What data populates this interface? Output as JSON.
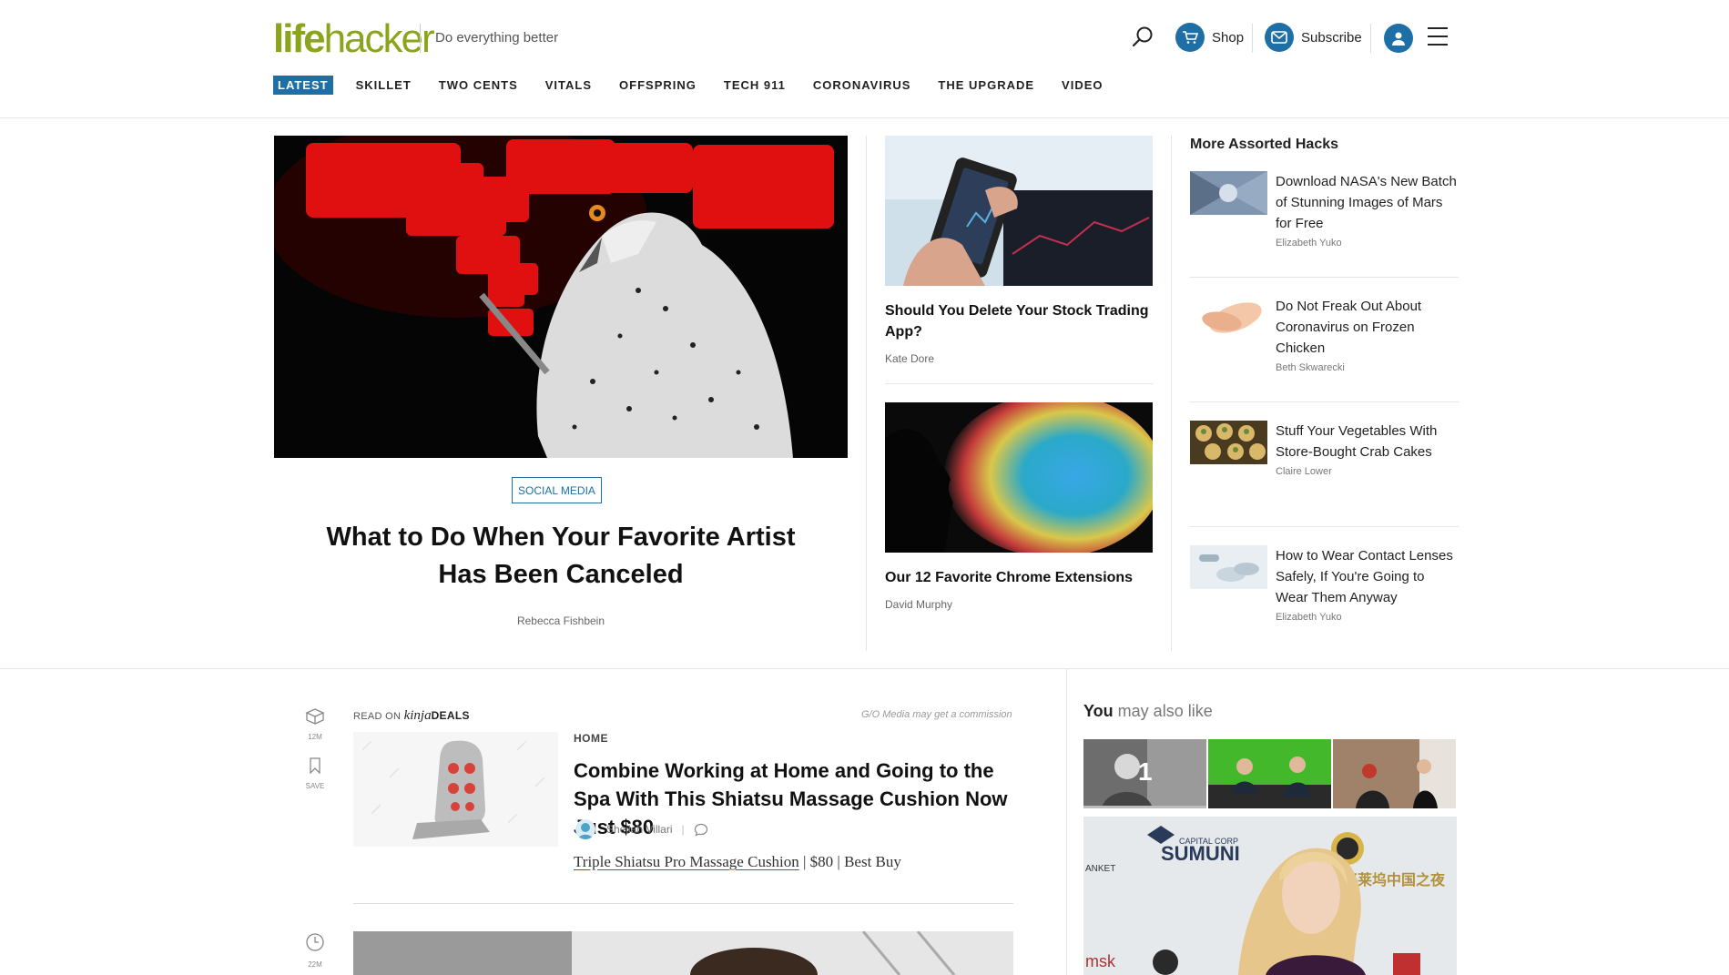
{
  "site": {
    "logo_part1": "life",
    "logo_part2": "hacker",
    "tagline": "Do everything better"
  },
  "header": {
    "shop_label": "Shop",
    "subscribe_label": "Subscribe"
  },
  "nav": [
    "LATEST",
    "SKILLET",
    "TWO CENTS",
    "VITALS",
    "OFFSPRING",
    "TECH 911",
    "CORONAVIRUS",
    "THE UPGRADE",
    "VIDEO"
  ],
  "hero": {
    "tag": "SOCIAL MEDIA",
    "title": "What to Do When Your Favorite Artist Has Been Canceled",
    "author": "Rebecca Fishbein"
  },
  "middle": [
    {
      "title": "Should You Delete Your Stock Trading App?",
      "author": "Kate Dore"
    },
    {
      "title": "Our 12 Favorite Chrome Extensions",
      "author": "David Murphy"
    }
  ],
  "hacks": {
    "heading": "More Assorted Hacks",
    "items": [
      {
        "title": "Download NASA's New Batch of Stunning Images of Mars for Free",
        "author": "Elizabeth Yuko"
      },
      {
        "title": "Do Not Freak Out About Coronavirus on Frozen Chicken",
        "author": "Beth Skwarecki"
      },
      {
        "title": "Stuff Your Vegetables With Store-Bought Crab Cakes",
        "author": "Claire Lower"
      },
      {
        "title": "How to Wear Contact Lenses Safely, If You're Going to Wear Them Anyway",
        "author": "Elizabeth Yuko"
      }
    ]
  },
  "feed": {
    "icon_time_1": "12M",
    "icon_save": "SAVE",
    "icon_time_2": "22M",
    "read_on": "READ ON",
    "kinja": "kinja",
    "deals": "DEALS",
    "commission": "G/O Media may get a commission",
    "category": "HOME",
    "title": "Combine Working at Home and Going to the Spa With This Shiatsu Massage Cushion Now Just $80",
    "author": "Sheilah Villari",
    "byline_sep": "|",
    "product_link": "Triple Shiatsu Pro Massage Cushion",
    "product_price": "| $80 | Best Buy"
  },
  "also_like": {
    "you": "You",
    "rest": " may also like",
    "thumb1_number": "1"
  }
}
